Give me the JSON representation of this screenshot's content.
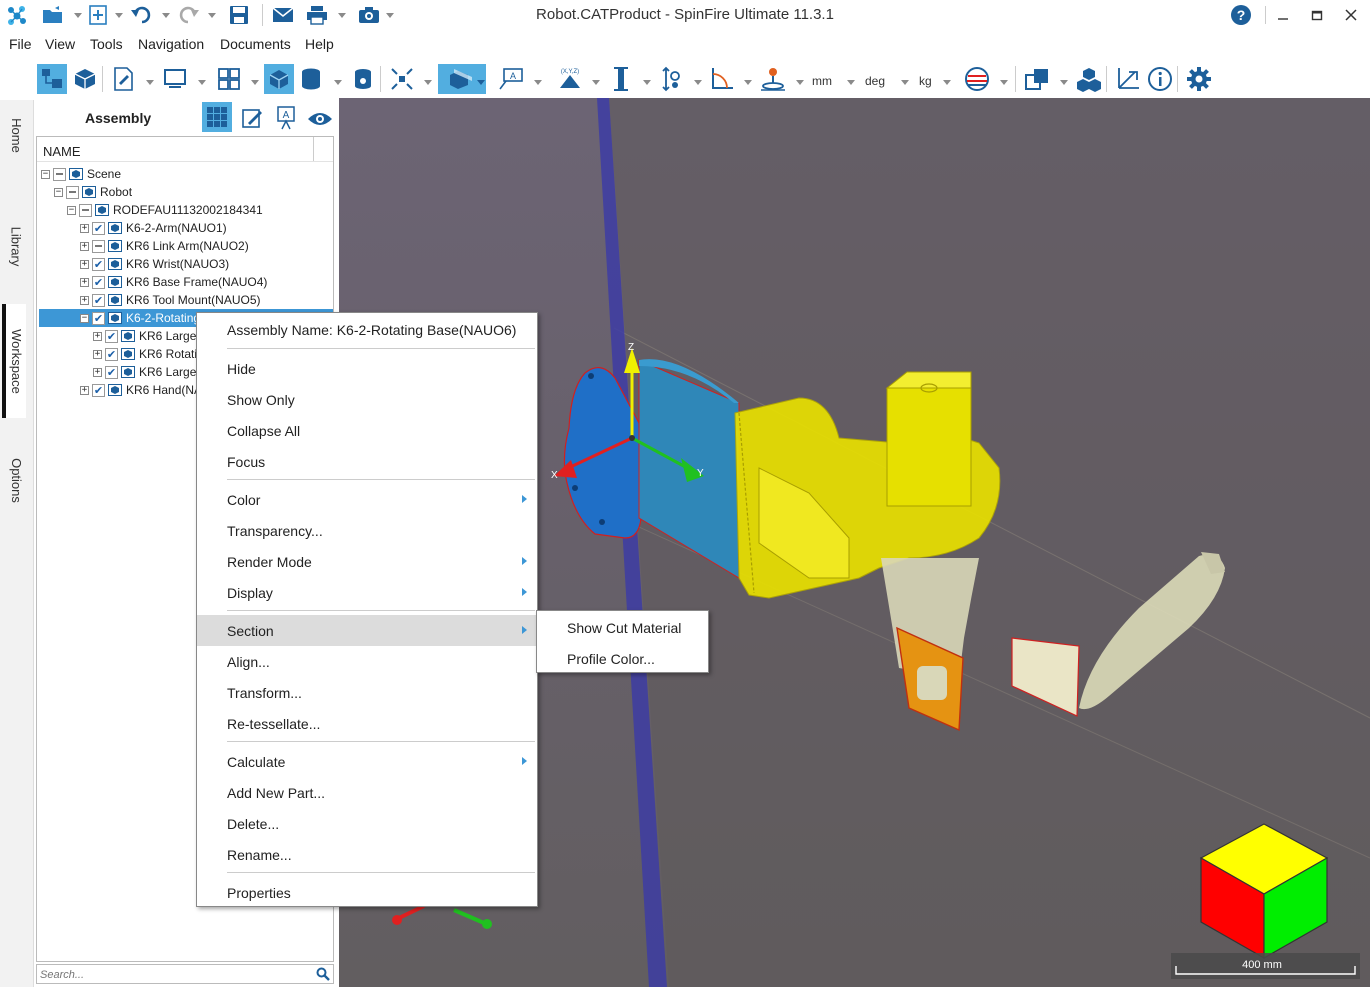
{
  "window": {
    "title": "Robot.CATProduct - SpinFire Ultimate 11.3.1"
  },
  "quick_access": {
    "icons": [
      "app-logo-icon",
      "open-folder-icon",
      "new-icon",
      "undo-icon",
      "redo-icon",
      "save-icon",
      "email-icon",
      "print-icon",
      "screenshot-icon"
    ]
  },
  "window_controls": [
    "help-icon",
    "minimize-icon",
    "maximize-icon",
    "close-icon"
  ],
  "menu": [
    "File",
    "View",
    "Tools",
    "Navigation",
    "Documents",
    "Help"
  ],
  "toolbar": {
    "units": {
      "length": "mm",
      "angle": "deg",
      "mass": "kg"
    }
  },
  "side_tabs": [
    {
      "label": "Home",
      "selected": false
    },
    {
      "label": "Library",
      "selected": false
    },
    {
      "label": "Workspace",
      "selected": true
    },
    {
      "label": "Options",
      "selected": false
    }
  ],
  "panel": {
    "title": "Assembly",
    "column_header": "NAME",
    "search_placeholder": "Search..."
  },
  "tree": [
    {
      "label": "Scene",
      "checked": "partial",
      "expanded": true,
      "selected": false
    },
    {
      "label": "Robot",
      "checked": "partial",
      "expanded": true,
      "selected": false
    },
    {
      "label": "RODEFAU11132002184341",
      "checked": "partial",
      "expanded": true,
      "selected": false
    },
    {
      "label": "K6-2-Arm(NAUO1)",
      "checked": "true",
      "expanded": false,
      "selected": false
    },
    {
      "label": "KR6 Link Arm(NAUO2)",
      "checked": "partial",
      "expanded": false,
      "selected": false
    },
    {
      "label": "KR6 Wrist(NAUO3)",
      "checked": "true",
      "expanded": false,
      "selected": false
    },
    {
      "label": "KR6 Base Frame(NAUO4)",
      "checked": "true",
      "expanded": false,
      "selected": false
    },
    {
      "label": "KR6 Tool Mount(NAUO5)",
      "checked": "true",
      "expanded": false,
      "selected": false
    },
    {
      "label": "K6-2-Rotating",
      "checked": "true",
      "expanded": true,
      "selected": true
    },
    {
      "label": "KR6 Large",
      "checked": "true",
      "expanded": false,
      "selected": false
    },
    {
      "label": "KR6 Rotati",
      "checked": "true",
      "expanded": false,
      "selected": false
    },
    {
      "label": "KR6 Large",
      "checked": "true",
      "expanded": false,
      "selected": false
    },
    {
      "label": "KR6 Hand(NA",
      "checked": "true",
      "expanded": false,
      "selected": false
    }
  ],
  "context_menu": {
    "header": "Assembly Name: K6-2-Rotating Base(NAUO6)",
    "items": [
      {
        "label": "Hide",
        "submenu": false
      },
      {
        "label": "Show Only",
        "submenu": false
      },
      {
        "label": "Collapse All",
        "submenu": false
      },
      {
        "label": "Focus",
        "submenu": false
      },
      {
        "label": "Color",
        "submenu": true
      },
      {
        "label": "Transparency...",
        "submenu": false
      },
      {
        "label": "Render Mode",
        "submenu": true
      },
      {
        "label": "Display",
        "submenu": true
      },
      {
        "label": "Section",
        "submenu": true,
        "highlighted": true
      },
      {
        "label": "Align...",
        "submenu": false
      },
      {
        "label": "Transform...",
        "submenu": false
      },
      {
        "label": "Re-tessellate...",
        "submenu": false
      },
      {
        "label": "Calculate",
        "submenu": true
      },
      {
        "label": "Add New Part...",
        "submenu": false
      },
      {
        "label": "Delete...",
        "submenu": false
      },
      {
        "label": "Rename...",
        "submenu": false
      },
      {
        "label": "Properties",
        "submenu": false
      }
    ]
  },
  "submenu": {
    "items": [
      "Show Cut Material",
      "Profile Color..."
    ]
  },
  "viewport": {
    "axis_labels": {
      "x": "X",
      "y": "Y",
      "z": "Z"
    },
    "scale_bar": "400 mm",
    "colors": {
      "selected_part": "#1f6fc7",
      "highlight_part": "#e8e000",
      "axis_x": "#e02020",
      "axis_y": "#20c020",
      "axis_z": "#f0f000",
      "background": "#67606a"
    }
  }
}
